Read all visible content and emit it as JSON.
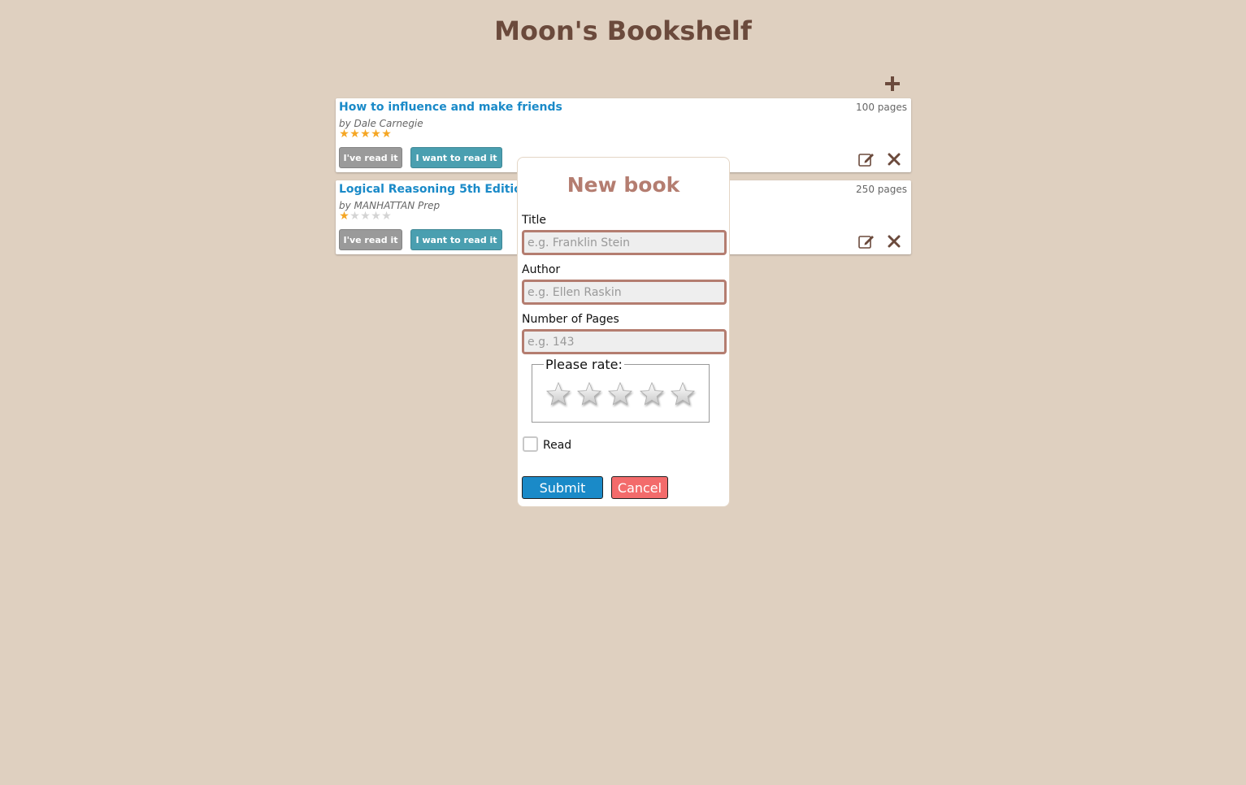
{
  "app": {
    "title": "Moon's Bookshelf"
  },
  "header": {
    "add_icon": "plus-icon"
  },
  "books": [
    {
      "title": "How to influence and make friends",
      "author": "by Dale Carnegie",
      "pages": "100 pages",
      "rating": 5,
      "max_rating": 5,
      "read_label": "I've read it",
      "want_label": "I want to read it"
    },
    {
      "title": "Logical Reasoning 5th Edition",
      "author": "by MANHATTAN Prep",
      "pages": "250 pages",
      "rating": 1,
      "max_rating": 5,
      "read_label": "I've read it",
      "want_label": "I want to read it"
    }
  ],
  "modal": {
    "title": "New book",
    "fields": [
      {
        "label": "Title",
        "placeholder": "e.g. Franklin Stein",
        "value": ""
      },
      {
        "label": "Author",
        "placeholder": "e.g. Ellen Raskin",
        "value": ""
      },
      {
        "label": "Number of Pages",
        "placeholder": "e.g. 143",
        "value": ""
      }
    ],
    "rating_legend": "Please rate:",
    "rating_value": 0,
    "read_label": "Read",
    "read_checked": false,
    "submit_label": "Submit",
    "cancel_label": "Cancel"
  },
  "colors": {
    "background": "#dfd0c0",
    "title_brown": "#6b4a3c",
    "link_blue": "#1a8ac8",
    "star_gold": "#f5a623",
    "modal_accent": "#b47d70",
    "cancel_red": "#f36b6b"
  }
}
